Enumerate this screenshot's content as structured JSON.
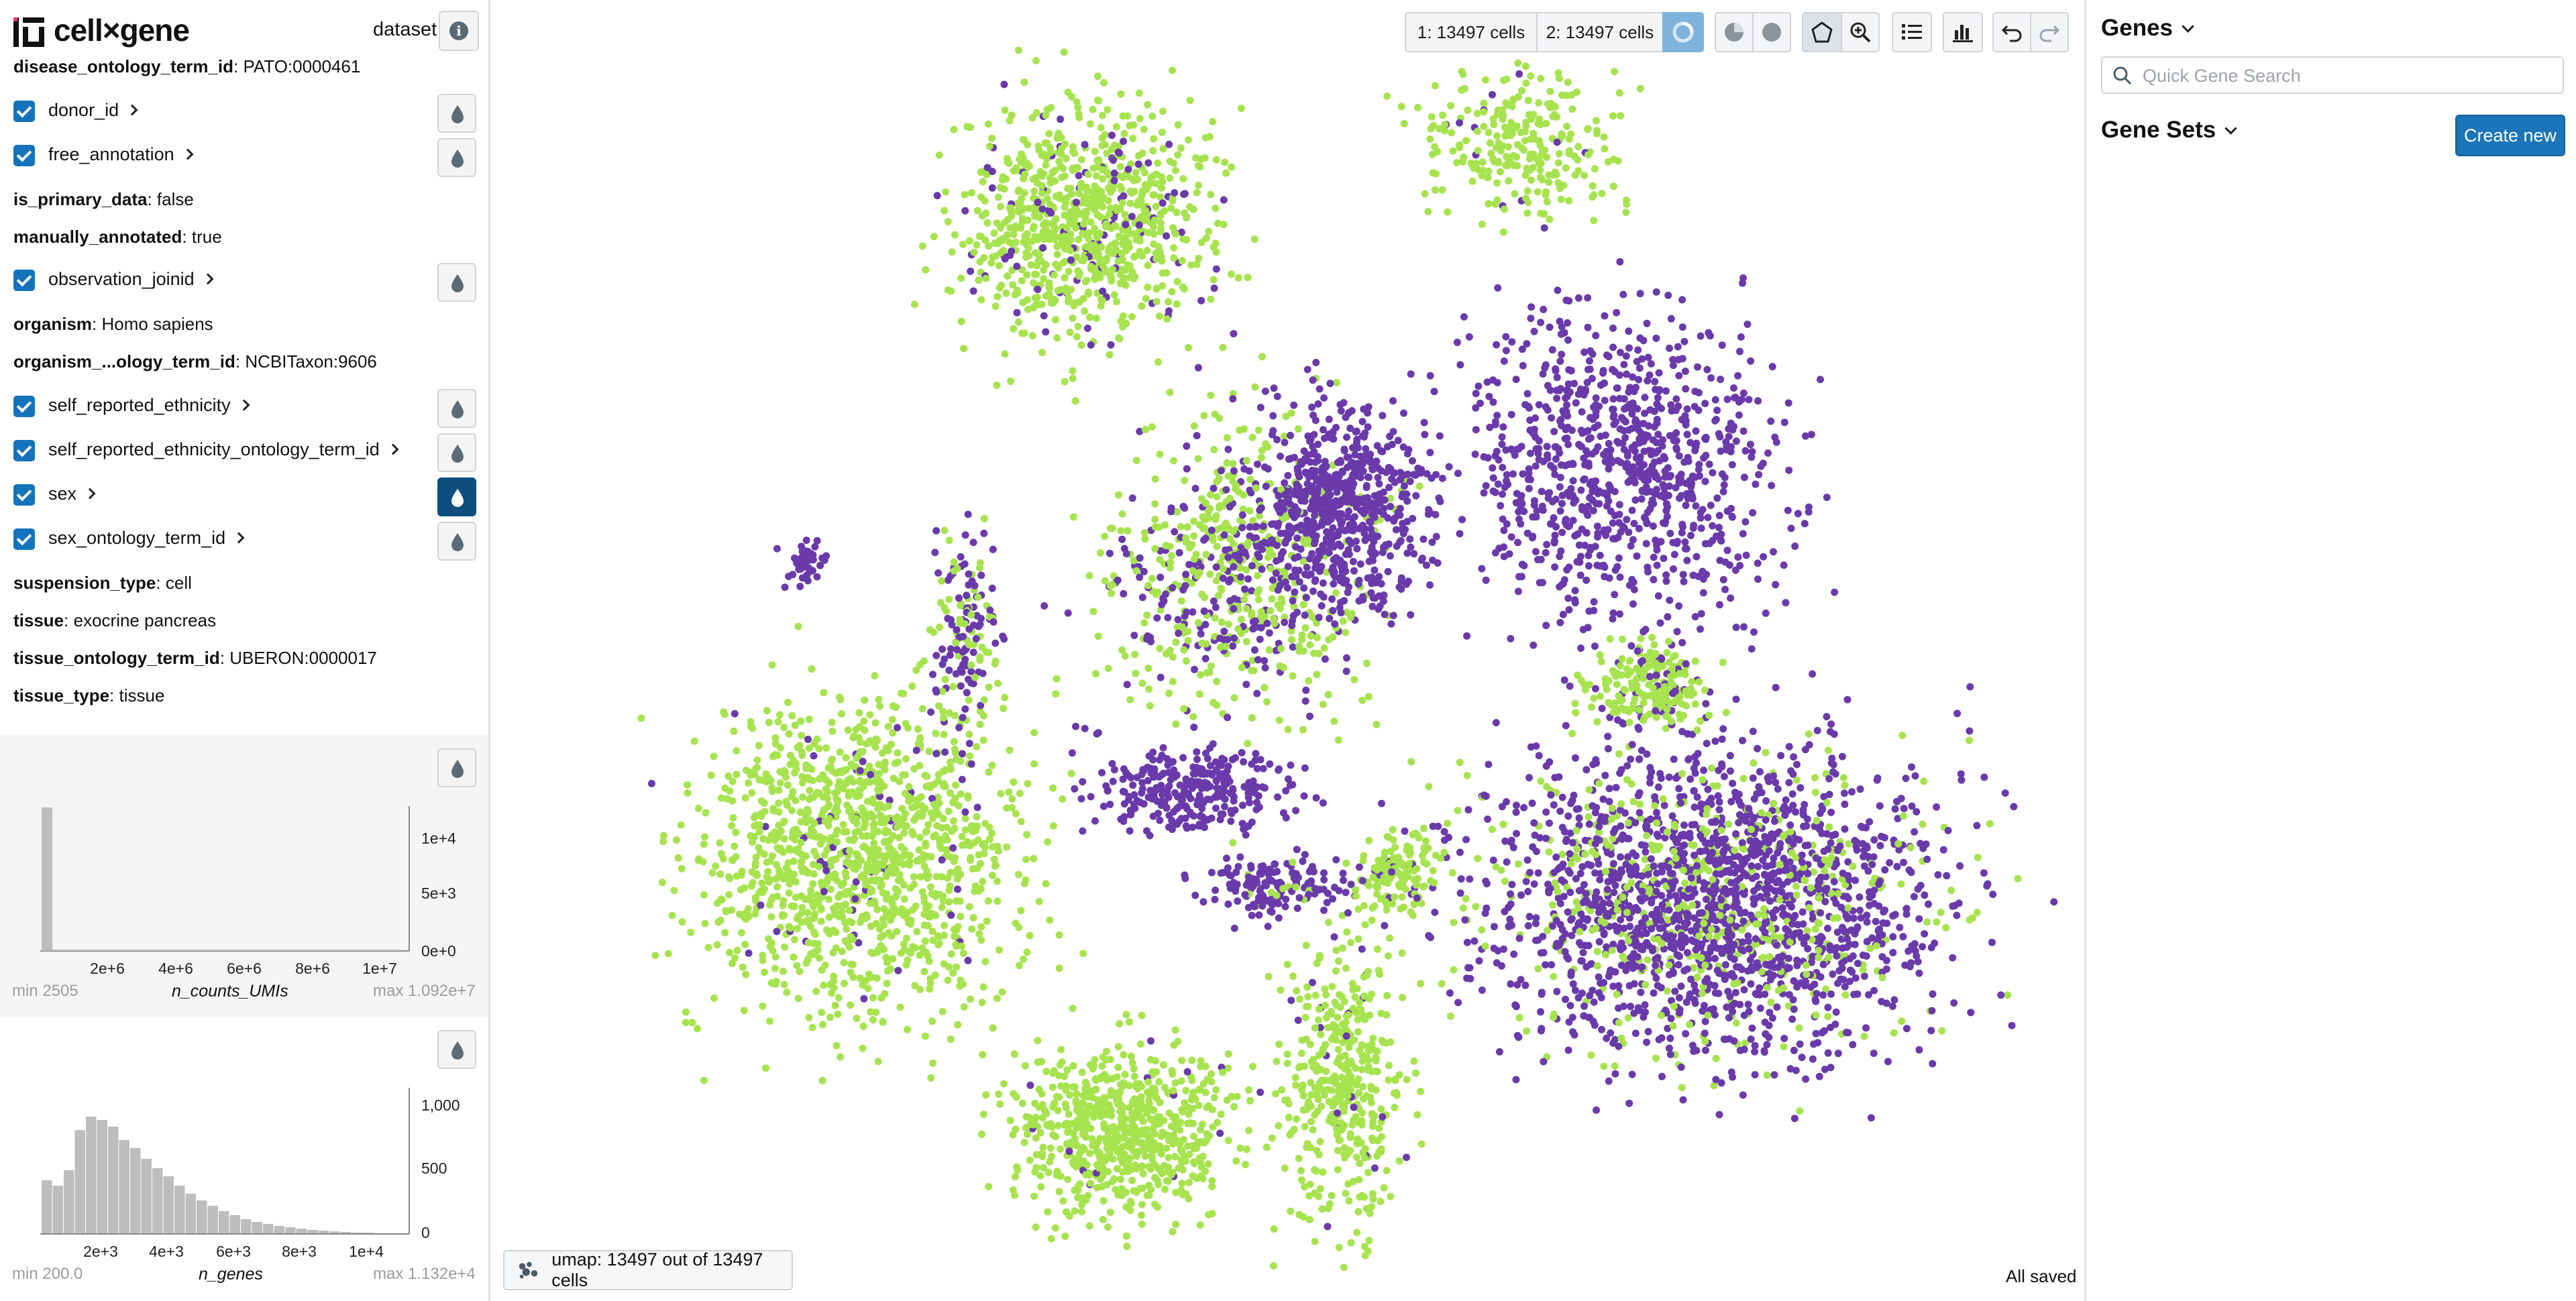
{
  "app": {
    "title": "cell×gene",
    "dataset_label": "dataset"
  },
  "metadata": {
    "disease_ontology": {
      "key": "disease_ontology_term_id",
      "value": "PATO:0000461"
    },
    "is_primary_data": {
      "key": "is_primary_data",
      "value": "false"
    },
    "manually_annotated": {
      "key": "manually_annotated",
      "value": "true"
    },
    "organism": {
      "key": "organism",
      "value": "Homo sapiens"
    },
    "organism_ontology": {
      "key": "organism_...ology_term_id",
      "value": "NCBITaxon:9606"
    },
    "suspension_type": {
      "key": "suspension_type",
      "value": "cell"
    },
    "tissue": {
      "key": "tissue",
      "value": "exocrine pancreas"
    },
    "tissue_ontology": {
      "key": "tissue_ontology_term_id",
      "value": "UBERON:0000017"
    },
    "tissue_type": {
      "key": "tissue_type",
      "value": "tissue"
    }
  },
  "categories": [
    {
      "label": "donor_id",
      "checked": true,
      "color_active": false
    },
    {
      "label": "free_annotation",
      "checked": true,
      "color_active": false
    },
    {
      "label": "observation_joinid",
      "checked": true,
      "color_active": false
    },
    {
      "label": "self_reported_ethnicity",
      "checked": true,
      "color_active": false
    },
    {
      "label": "self_reported_ethnicity_ontology_term_id",
      "checked": true,
      "color_active": false
    },
    {
      "label": "sex",
      "checked": true,
      "color_active": true
    },
    {
      "label": "sex_ontology_term_id",
      "checked": true,
      "color_active": false
    }
  ],
  "histograms": {
    "umis": {
      "name": "n_counts_UMIs",
      "min": "min 2505",
      "max": "max 1.092e+7",
      "x_ticks": [
        "2e+6",
        "4e+6",
        "6e+6",
        "8e+6",
        "1e+7"
      ],
      "y_ticks": [
        "1e+4",
        "5e+3",
        "0e+0"
      ]
    },
    "genes": {
      "name": "n_genes",
      "min": "min 200.0",
      "max": "max 1.132e+4",
      "x_ticks": [
        "2e+3",
        "4e+3",
        "6e+3",
        "8e+3",
        "1e+4"
      ],
      "y_ticks": [
        "1,000",
        "500",
        "0"
      ]
    }
  },
  "toolbar": {
    "selection1": "1: 13497 cells",
    "selection2": "2: 13497 cells"
  },
  "embedding": {
    "label": "umap: 13497 out of 13497 cells"
  },
  "status": {
    "saved": "All saved"
  },
  "right_panel": {
    "genes_title": "Genes",
    "search_placeholder": "Quick Gene Search",
    "gene_sets_title": "Gene Sets",
    "create_new": "Create new"
  },
  "colors": {
    "accent": "#1473bb",
    "green_cells": "#a7e34f",
    "purple_cells": "#6a3aab"
  }
}
